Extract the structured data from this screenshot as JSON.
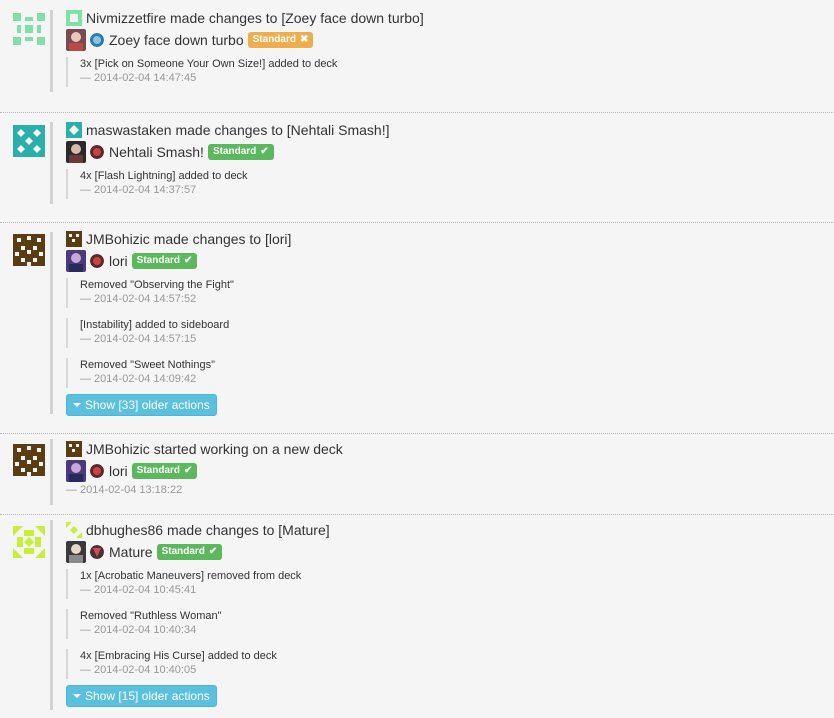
{
  "feed": [
    {
      "user": "Nivmizzetfire",
      "verb": "made changes to",
      "deck_ref": "[Zoey face down turbo]",
      "deck_name": "Zoey face down turbo",
      "badge": {
        "label": "Standard",
        "color": "#f0ad4e",
        "icon": "cross-icon"
      },
      "avatar_color": "#7fe0a8",
      "mana_icon": "blue-mana-icon",
      "actions": [
        {
          "text": "3x [Pick on Someone Your Own Size!] added to deck",
          "time": "— 2014-02-04 14:47:45"
        }
      ]
    },
    {
      "user": "maswastaken",
      "verb": "made changes to",
      "deck_ref": "[Nehtali Smash!]",
      "deck_name": "Nehtali Smash!",
      "badge": {
        "label": "Standard",
        "color": "#5cb85c",
        "icon": "check-icon"
      },
      "avatar_color": "#2ab0a8",
      "mana_icon": "red-mana-icon",
      "actions": [
        {
          "text": "4x [Flash Lightning] added to deck",
          "time": "— 2014-02-04 14:37:57"
        }
      ]
    },
    {
      "user": "JMBohizic",
      "verb": "made changes to",
      "deck_ref": "[lori]",
      "deck_name": "lori",
      "badge": {
        "label": "Standard",
        "color": "#5cb85c",
        "icon": "check-icon"
      },
      "avatar_color": "#5a3d12",
      "mana_icon": "red-mana-icon",
      "actions": [
        {
          "text": "Removed \"Observing the Fight\"",
          "time": "— 2014-02-04 14:57:52"
        },
        {
          "text": "[Instability] added to sideboard",
          "time": "— 2014-02-04 14:57:15"
        },
        {
          "text": "Removed \"Sweet Nothings\"",
          "time": "— 2014-02-04 14:09:42"
        }
      ],
      "older_button": "Show [33] older actions"
    },
    {
      "user": "JMBohizic",
      "verb": "started working on a new deck",
      "deck_ref": "",
      "deck_name": "lori",
      "badge": {
        "label": "Standard",
        "color": "#5cb85c",
        "icon": "check-icon"
      },
      "avatar_color": "#5a3d12",
      "mana_icon": "red-mana-icon",
      "timestamp": "— 2014-02-04 13:18:22"
    },
    {
      "user": "dbhughes86",
      "verb": "made changes to",
      "deck_ref": "[Mature]",
      "deck_name": "Mature",
      "badge": {
        "label": "Standard",
        "color": "#5cb85c",
        "icon": "check-icon"
      },
      "avatar_color": "#c8ee3a",
      "mana_icon": "shield-mana-icon",
      "actions": [
        {
          "text": "1x [Acrobatic Maneuvers] removed from deck",
          "time": "— 2014-02-04 10:45:41"
        },
        {
          "text": "Removed \"Ruthless Woman\"",
          "time": "— 2014-02-04 10:40:34"
        },
        {
          "text": "4x [Embracing His Curse] added to deck",
          "time": "— 2014-02-04 10:40:05"
        }
      ],
      "older_button": "Show [15] older actions"
    }
  ]
}
